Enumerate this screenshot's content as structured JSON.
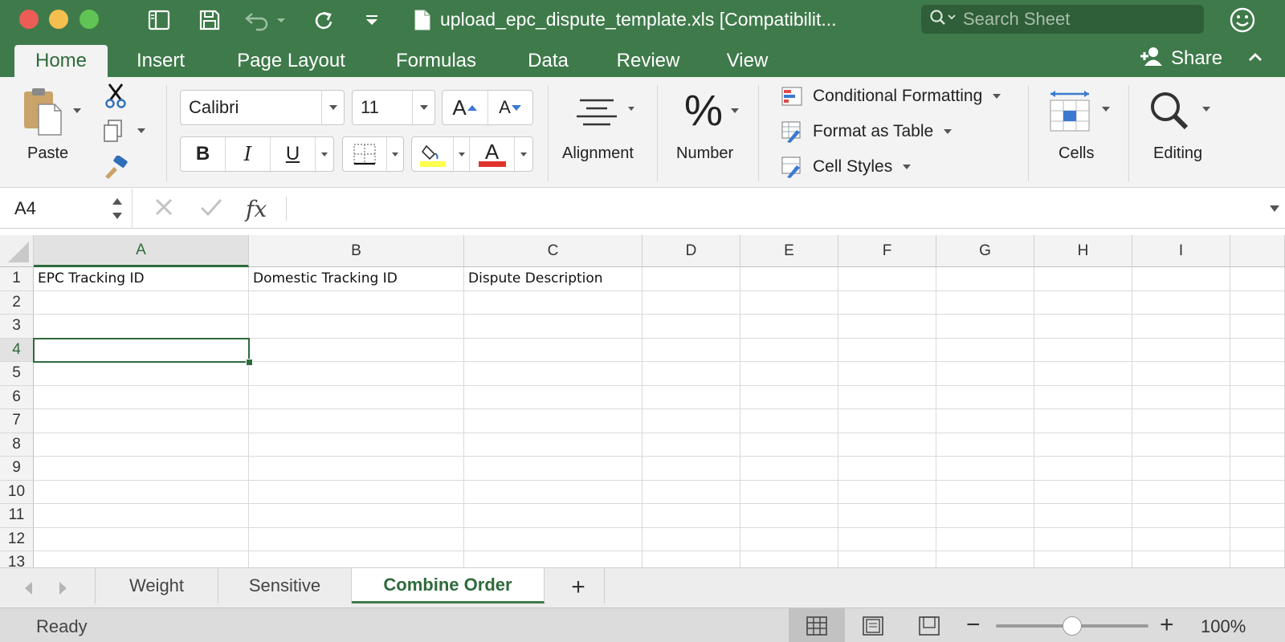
{
  "window": {
    "title": "upload_epc_dispute_template.xls  [Compatibilit...",
    "search_placeholder": "Search Sheet"
  },
  "ribbon_tabs": [
    {
      "label": "Home",
      "active": true
    },
    {
      "label": "Insert"
    },
    {
      "label": "Page Layout"
    },
    {
      "label": "Formulas"
    },
    {
      "label": "Data"
    },
    {
      "label": "Review"
    },
    {
      "label": "View"
    }
  ],
  "share_label": "Share",
  "ribbon": {
    "paste_label": "Paste",
    "font_name": "Calibri",
    "font_size": "11",
    "bold": "B",
    "italic": "I",
    "underline": "U",
    "grow_font": "A",
    "shrink_font": "A",
    "font_color_glyph": "A",
    "alignment_label": "Alignment",
    "number_label": "Number",
    "number_glyph": "%",
    "conditional_formatting": "Conditional Formatting",
    "format_as_table": "Format as Table",
    "cell_styles": "Cell Styles",
    "cells_label": "Cells",
    "editing_label": "Editing",
    "fill_color": "#ffff4d",
    "font_color": "#e0352b"
  },
  "formula_bar": {
    "name_box": "A4",
    "fx": "fx",
    "value": ""
  },
  "grid": {
    "columns": [
      "A",
      "B",
      "C",
      "D",
      "E",
      "F",
      "G",
      "H",
      "I"
    ],
    "rows": [
      "1",
      "2",
      "3",
      "4",
      "5",
      "6",
      "7",
      "8",
      "9",
      "10",
      "11",
      "12",
      "13"
    ],
    "row1": [
      "EPC Tracking ID",
      "Domestic Tracking ID",
      "Dispute Description",
      "",
      "",
      "",
      "",
      "",
      ""
    ],
    "selected_cell": "A4"
  },
  "sheets": [
    {
      "label": "Weight"
    },
    {
      "label": "Sensitive"
    },
    {
      "label": "Combine Order",
      "active": true
    }
  ],
  "status": {
    "text": "Ready",
    "zoom": "100%",
    "zoom_fraction": 0.5
  },
  "colors": {
    "accent": "#3f7a4a",
    "selection": "#2f6a3b"
  }
}
